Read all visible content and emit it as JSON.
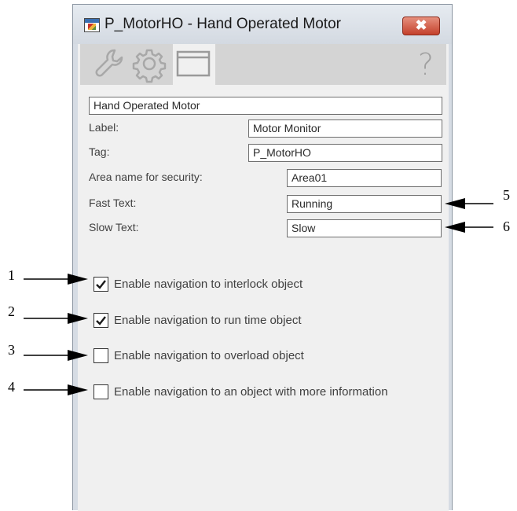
{
  "window": {
    "title": "P_MotorHO - Hand Operated Motor",
    "close_glyph": "✖"
  },
  "toolbar": {
    "icons": [
      "wrench-icon",
      "gear-icon",
      "window-icon",
      "help-icon"
    ],
    "help_glyph": "?"
  },
  "form": {
    "description": "Hand Operated Motor",
    "label_caption": "Label:",
    "label_value": "Motor Monitor",
    "tag_caption": "Tag:",
    "tag_value": "P_MotorHO",
    "area_caption": "Area name for security:",
    "area_value": "Area01",
    "fast_caption": "Fast Text:",
    "fast_value": "Running",
    "slow_caption": "Slow Text:",
    "slow_value": "Slow"
  },
  "checkboxes": [
    {
      "label": "Enable navigation to interlock object",
      "checked": true
    },
    {
      "label": "Enable navigation to run time object",
      "checked": true
    },
    {
      "label": "Enable navigation to overload object",
      "checked": false
    },
    {
      "label": "Enable navigation to an object with more information",
      "checked": false
    }
  ],
  "callouts": [
    "1",
    "2",
    "3",
    "4",
    "5",
    "6"
  ]
}
